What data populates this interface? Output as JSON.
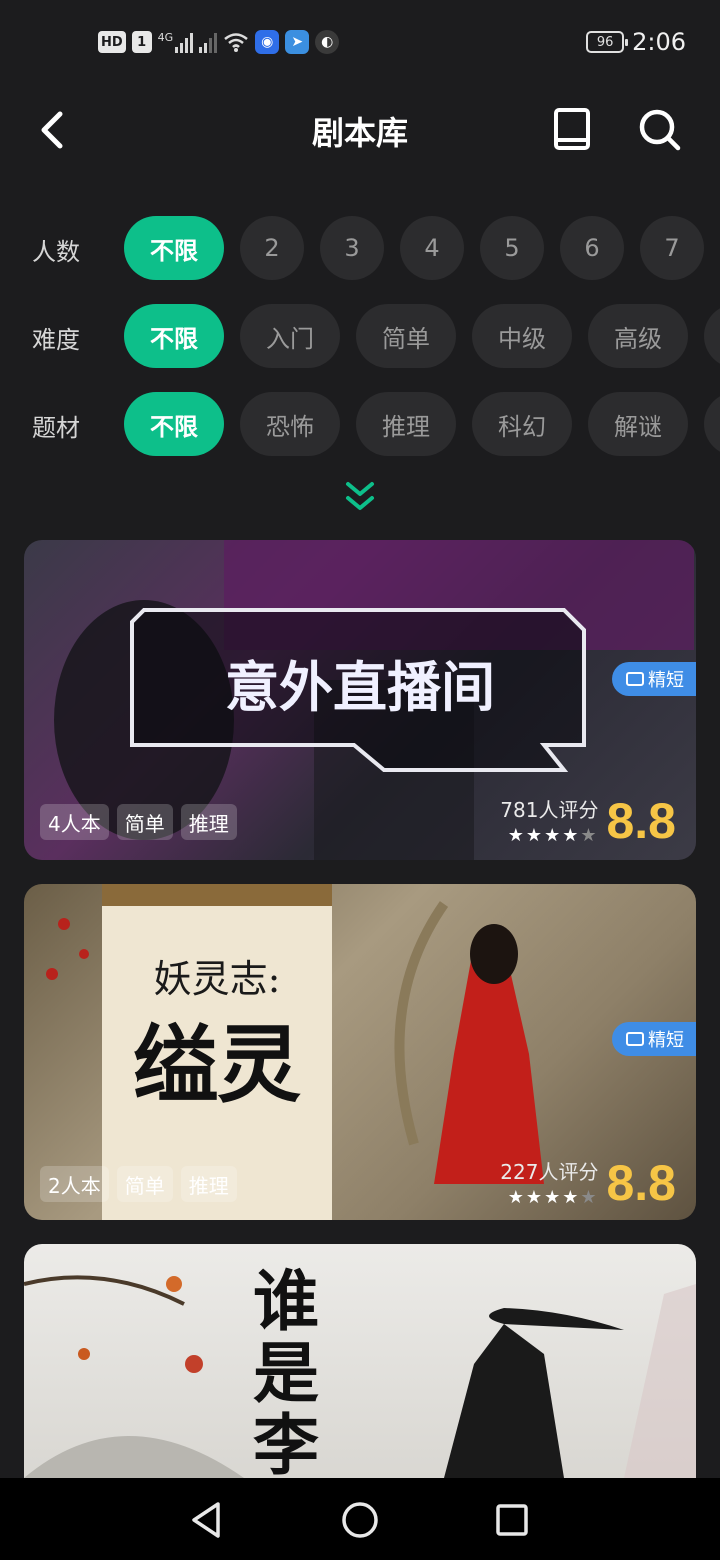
{
  "status_bar": {
    "hd": "HD",
    "sim": "1",
    "network": "4G",
    "battery": "96",
    "time": "2:06"
  },
  "header": {
    "title": "剧本库",
    "back_icon": "chevron-left-icon",
    "book_icon": "book-icon",
    "search_icon": "search-icon"
  },
  "filters": {
    "players": {
      "label": "人数",
      "options": [
        "不限",
        "2",
        "3",
        "4",
        "5",
        "6",
        "7"
      ],
      "selected": "不限"
    },
    "difficulty": {
      "label": "难度",
      "options": [
        "不限",
        "入门",
        "简单",
        "中级",
        "高级"
      ],
      "selected": "不限"
    },
    "theme": {
      "label": "题材",
      "options": [
        "不限",
        "恐怖",
        "推理",
        "科幻",
        "解谜"
      ],
      "selected": "不限"
    },
    "expand_icon": "double-chevron-down-icon"
  },
  "cards": [
    {
      "cover_title": "意外直播间",
      "tags": [
        "4人本",
        "简单",
        "推理"
      ],
      "badge": "精短",
      "rating_count": "781人评分",
      "score": "8.8",
      "stars": 4
    },
    {
      "cover_title": "妖灵志: 缢灵",
      "cover_subtitle": "妖灵志:",
      "cover_main": "缢灵",
      "tags": [
        "2人本",
        "简单",
        "推理"
      ],
      "badge": "精短",
      "rating_count": "227人评分",
      "score": "8.8",
      "stars": 4
    },
    {
      "cover_title": "谁是李",
      "cover_chars": [
        "谁",
        "是",
        "李"
      ]
    }
  ],
  "colors": {
    "accent": "#0dbf8a",
    "score": "#f6c546",
    "badge": "#3f8de6",
    "background": "#1c1c1e",
    "chip": "#2c2c2e"
  }
}
